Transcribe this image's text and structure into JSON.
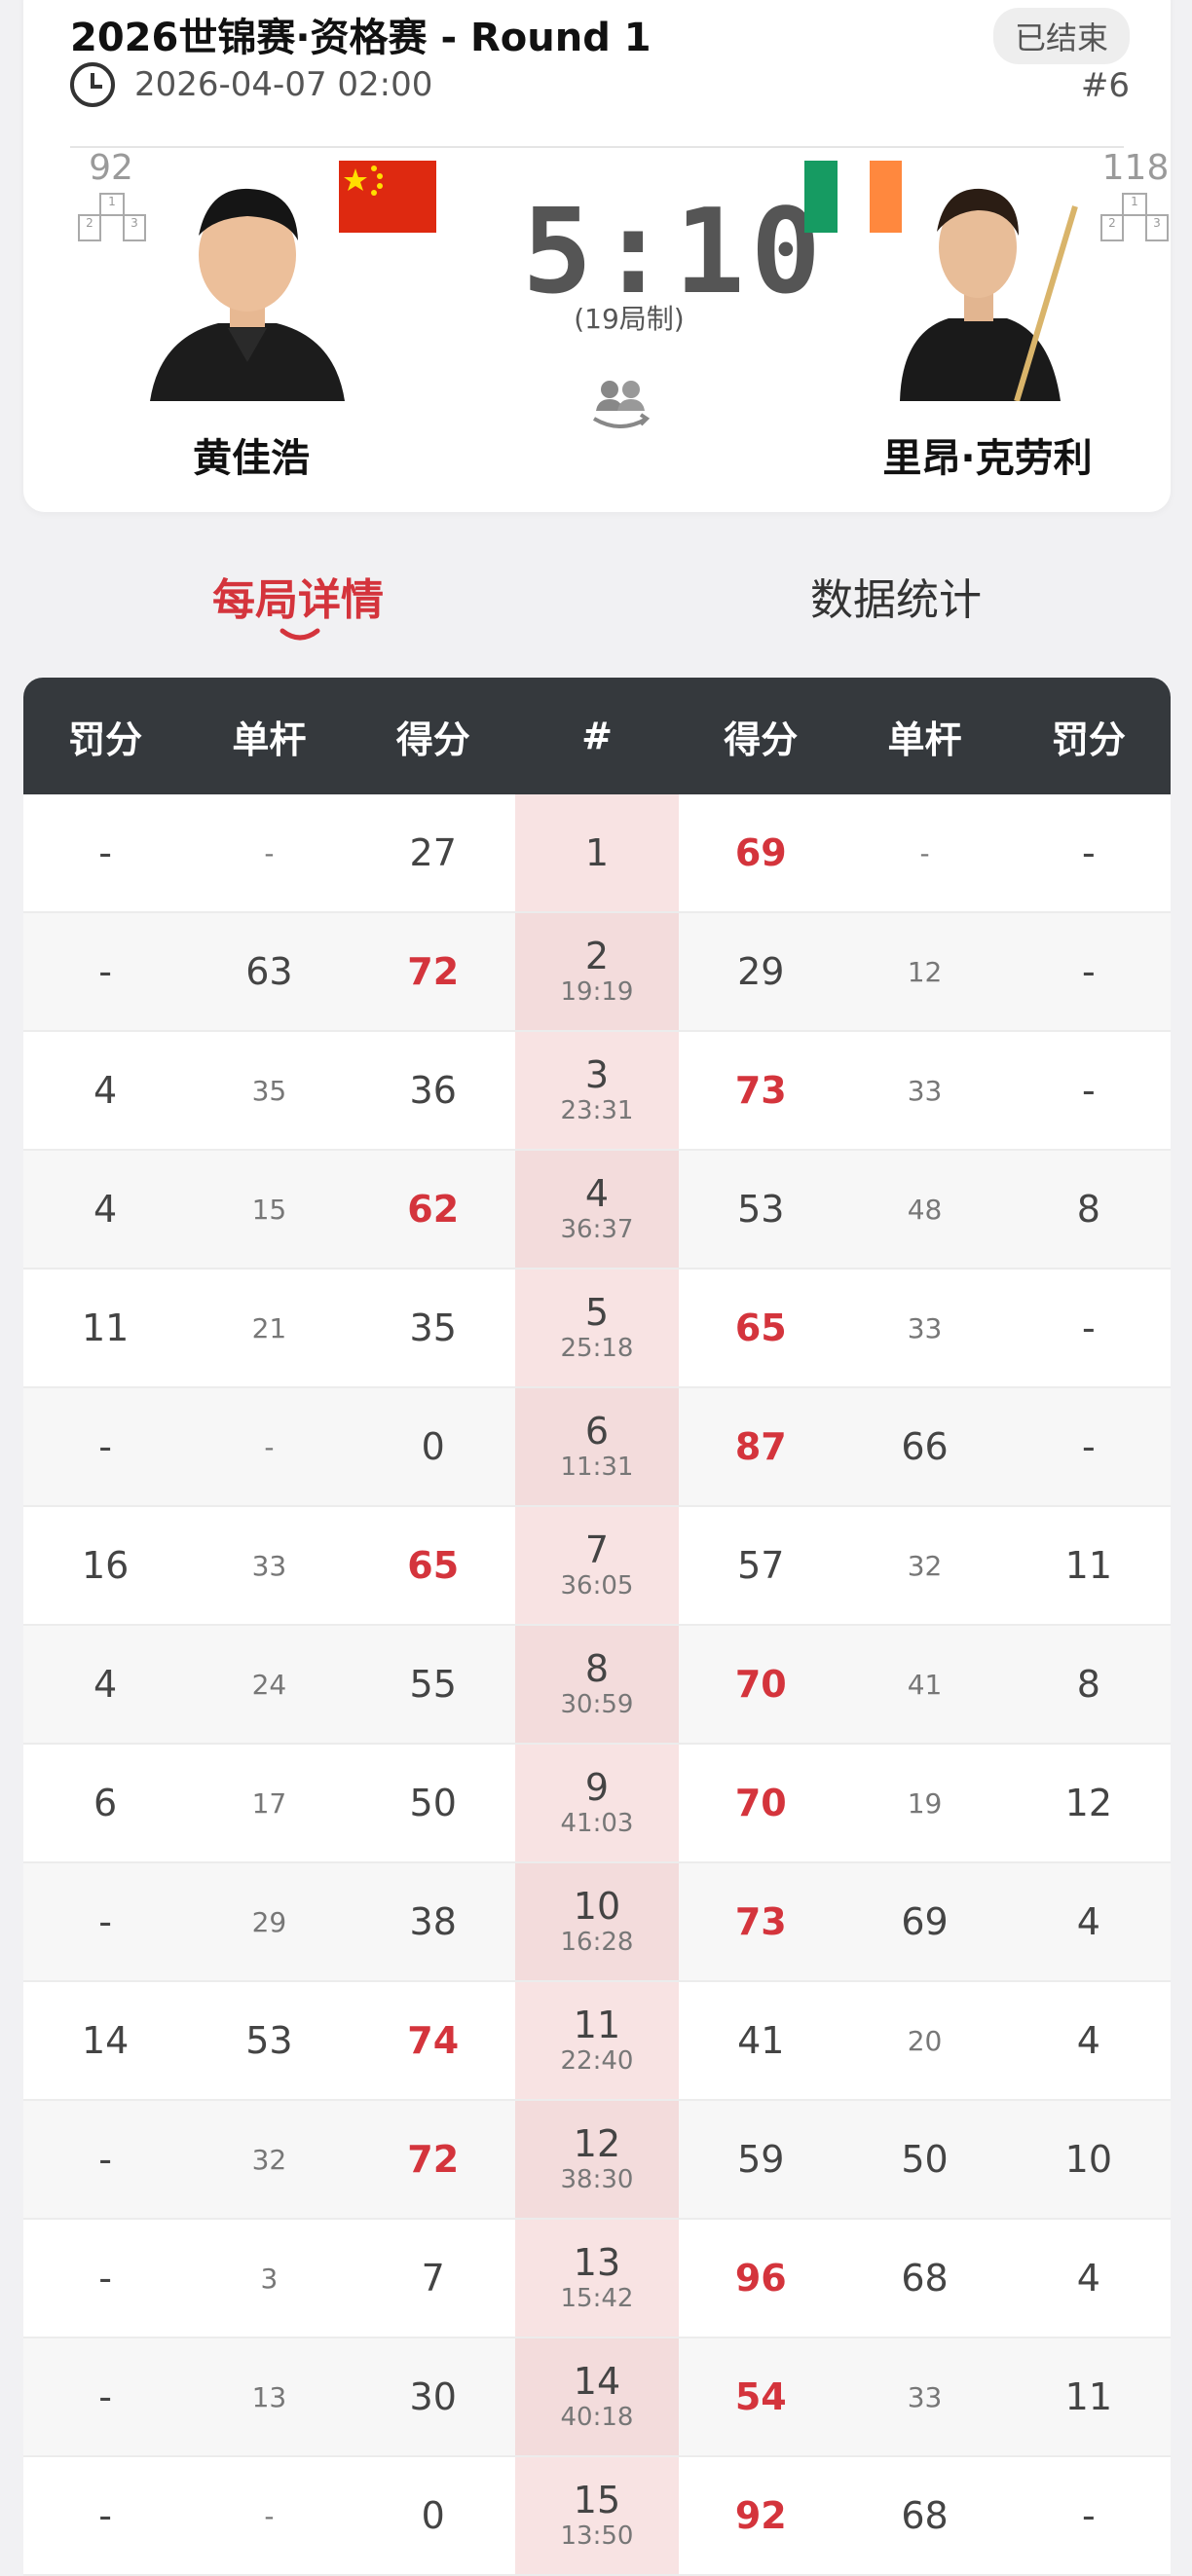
{
  "header": {
    "title": "2026世锦赛·资格赛 - Round 1",
    "status": "已结束",
    "datetime": "2026-04-07 02:00",
    "match_no": "#6"
  },
  "player_left": {
    "name": "黄佳浩",
    "rank": "92",
    "flag": "china"
  },
  "player_right": {
    "name": "里昂·克劳利",
    "rank": "118",
    "flag": "ireland"
  },
  "score": {
    "left": "5",
    "sep": ":",
    "right": "10",
    "format": "(19局制)"
  },
  "tabs": [
    "每局详情",
    "数据统计"
  ],
  "table": {
    "headers": [
      "罚分",
      "单杆",
      "得分",
      "#",
      "得分",
      "单杆",
      "罚分"
    ],
    "rows": [
      {
        "lp": "-",
        "lb": "-",
        "ls": "27",
        "no": "1",
        "time": "",
        "rs": "69",
        "rb": "-",
        "rp": "-",
        "win": "r"
      },
      {
        "lp": "-",
        "lb": "63",
        "ls": "72",
        "no": "2",
        "time": "19:19",
        "rs": "29",
        "rb": "12",
        "rp": "-",
        "win": "l"
      },
      {
        "lp": "4",
        "lb": "35",
        "ls": "36",
        "no": "3",
        "time": "23:31",
        "rs": "73",
        "rb": "33",
        "rp": "-",
        "win": "r"
      },
      {
        "lp": "4",
        "lb": "15",
        "ls": "62",
        "no": "4",
        "time": "36:37",
        "rs": "53",
        "rb": "48",
        "rp": "8",
        "win": "l"
      },
      {
        "lp": "11",
        "lb": "21",
        "ls": "35",
        "no": "5",
        "time": "25:18",
        "rs": "65",
        "rb": "33",
        "rp": "-",
        "win": "r"
      },
      {
        "lp": "-",
        "lb": "-",
        "ls": "0",
        "no": "6",
        "time": "11:31",
        "rs": "87",
        "rb": "66",
        "rp": "-",
        "win": "r"
      },
      {
        "lp": "16",
        "lb": "33",
        "ls": "65",
        "no": "7",
        "time": "36:05",
        "rs": "57",
        "rb": "32",
        "rp": "11",
        "win": "l"
      },
      {
        "lp": "4",
        "lb": "24",
        "ls": "55",
        "no": "8",
        "time": "30:59",
        "rs": "70",
        "rb": "41",
        "rp": "8",
        "win": "r"
      },
      {
        "lp": "6",
        "lb": "17",
        "ls": "50",
        "no": "9",
        "time": "41:03",
        "rs": "70",
        "rb": "19",
        "rp": "12",
        "win": "r"
      },
      {
        "lp": "-",
        "lb": "29",
        "ls": "38",
        "no": "10",
        "time": "16:28",
        "rs": "73",
        "rb": "69",
        "rp": "4",
        "win": "r"
      },
      {
        "lp": "14",
        "lb": "53",
        "ls": "74",
        "no": "11",
        "time": "22:40",
        "rs": "41",
        "rb": "20",
        "rp": "4",
        "win": "l"
      },
      {
        "lp": "-",
        "lb": "32",
        "ls": "72",
        "no": "12",
        "time": "38:30",
        "rs": "59",
        "rb": "50",
        "rp": "10",
        "win": "l"
      },
      {
        "lp": "-",
        "lb": "3",
        "ls": "7",
        "no": "13",
        "time": "15:42",
        "rs": "96",
        "rb": "68",
        "rp": "4",
        "win": "r"
      },
      {
        "lp": "-",
        "lb": "13",
        "ls": "30",
        "no": "14",
        "time": "40:18",
        "rs": "54",
        "rb": "33",
        "rp": "11",
        "win": "r"
      },
      {
        "lp": "-",
        "lb": "-",
        "ls": "0",
        "no": "15",
        "time": "13:50",
        "rs": "92",
        "rb": "68",
        "rp": "-",
        "win": "r"
      }
    ],
    "big_break_cells": {
      "lb": [
        "63",
        "53"
      ],
      "rb": [
        "66",
        "69",
        "50",
        "68"
      ]
    }
  }
}
